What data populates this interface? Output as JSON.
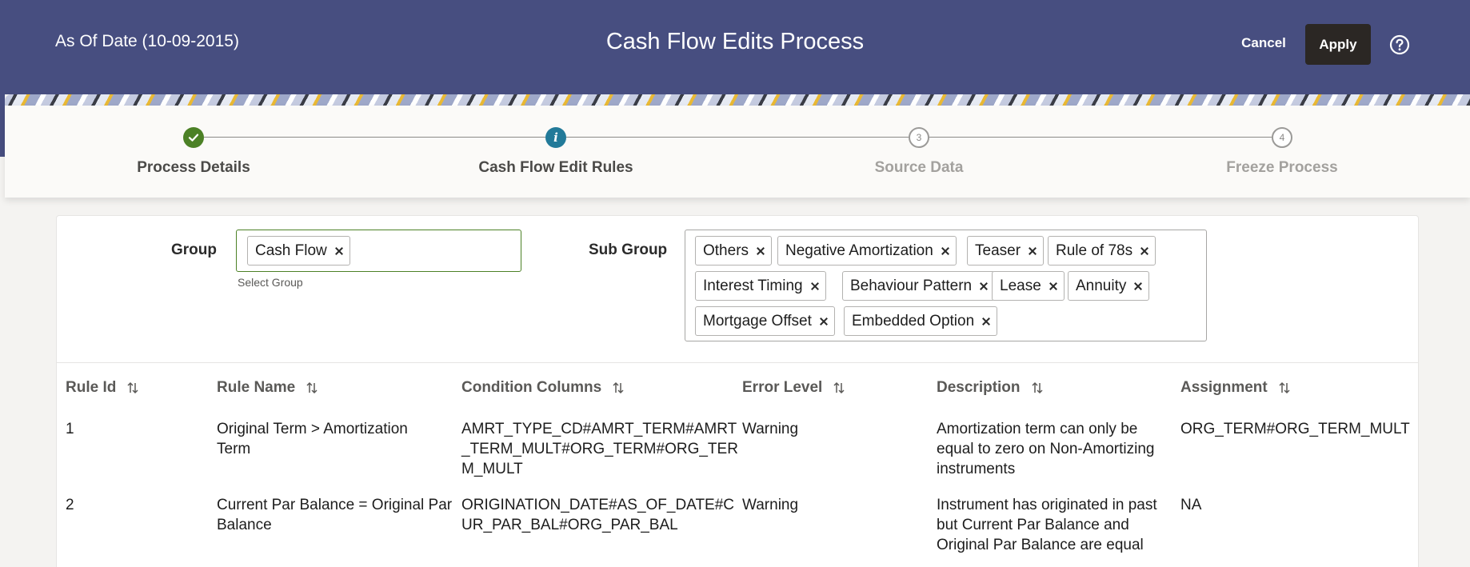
{
  "header": {
    "as_of_date": "As Of Date (10-09-2015)",
    "title": "Cash Flow Edits Process",
    "cancel_label": "Cancel",
    "apply_label": "Apply",
    "help_icon": "help-circle-icon"
  },
  "train": {
    "steps": [
      {
        "label": "Process Details",
        "state": "completed",
        "marker": "check-icon"
      },
      {
        "label": "Cash Flow Edit Rules",
        "state": "current",
        "marker": "i"
      },
      {
        "label": "Source Data",
        "state": "future",
        "marker": "3"
      },
      {
        "label": "Freeze Process",
        "state": "future",
        "marker": "4"
      }
    ]
  },
  "filters": {
    "group_label": "Group",
    "group_helper": "Select Group",
    "group_chips": [
      "Cash Flow"
    ],
    "subgroup_label": "Sub Group",
    "subgroup_chips": [
      "Others",
      "Negative Amortization",
      "Teaser",
      "Rule of 78s",
      "Interest Timing",
      "Behaviour Pattern",
      "Lease",
      "Annuity",
      "Mortgage Offset",
      "Embedded Option"
    ]
  },
  "table": {
    "columns": [
      "Rule Id",
      "Rule Name",
      "Condition Columns",
      "Error Level",
      "Description",
      "Assignment"
    ],
    "rows": [
      {
        "rule_id": "1",
        "rule_name": [
          "Original Term > Amortization",
          "Term"
        ],
        "condition_columns": [
          "AMRT_TYPE_CD#AMRT_TERM#AMRT",
          "_TERM_MULT#ORG_TERM#ORG_TER",
          "M_MULT"
        ],
        "error_level": "Warning",
        "description": [
          "Amortization term can only be",
          "equal to zero on Non-Amortizing",
          "instruments"
        ],
        "assignment": "ORG_TERM#ORG_TERM_MULT"
      },
      {
        "rule_id": "2",
        "rule_name": [
          "Current Par Balance = Original Par",
          "Balance"
        ],
        "condition_columns": [
          "ORIGINATION_DATE#AS_OF_DATE#C",
          "UR_PAR_BAL#ORG_PAR_BAL"
        ],
        "error_level": "Warning",
        "description": [
          "Instrument has originated in past",
          "but Current Par Balance and",
          "Original Par Balance are equal"
        ],
        "assignment": "NA"
      }
    ]
  },
  "colors": {
    "header_bg": "#474e80",
    "apply_bg": "#2b2724",
    "step_done": "#4c8126",
    "step_current": "#227a99"
  }
}
